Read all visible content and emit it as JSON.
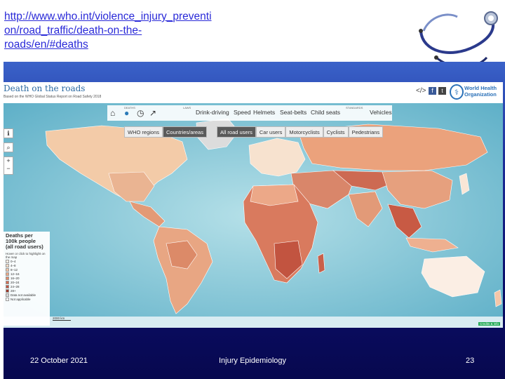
{
  "link": {
    "line1": "http://www.who.int/violence_injury_preventi",
    "line2": "on/road_traffic/death-on-the-",
    "line3": "roads/en/#deaths"
  },
  "screenshot": {
    "title": "Death on the roads",
    "subtitle": "Based on the WHO Global Status Report on Road Safety 2018",
    "who_name_line1": "World Health",
    "who_name_line2": "Organization",
    "toolbar": {
      "deaths_small": "DEATHS",
      "laws_small": "LAWS",
      "standards_small": "STANDARDS",
      "laws": [
        "Drink-driving",
        "Speed",
        "Helmets",
        "Seat-belts",
        "Child seats"
      ],
      "standards": [
        "Vehicles"
      ]
    },
    "region_tabs": [
      "WHO regions",
      "Countries/areas"
    ],
    "region_selected": "Countries/areas",
    "user_tabs": [
      "All road users",
      "Car users",
      "Motorcyclists",
      "Cyclists",
      "Pedestrians"
    ],
    "user_selected": "All road users",
    "legend": {
      "title_line1": "Deaths per",
      "title_line2": "100k people",
      "title_line3": "(all road users)",
      "hint": "Hover or click to highlight on the map",
      "items": [
        {
          "label": "0–4",
          "color": "#fbeee4"
        },
        {
          "label": "4–8",
          "color": "#f8dcc8"
        },
        {
          "label": "8–12",
          "color": "#f4c6a8"
        },
        {
          "label": "12–16",
          "color": "#eda886"
        },
        {
          "label": "16–20",
          "color": "#e48a68"
        },
        {
          "label": "20–24",
          "color": "#d56d52"
        },
        {
          "label": "24–28",
          "color": "#c2533f"
        },
        {
          "label": "28+",
          "color": "#9e3a2c"
        },
        {
          "label": "Data not available",
          "color": "#d8d8d8"
        },
        {
          "label": "Not applicable",
          "color": "#ffffff"
        }
      ]
    },
    "scale_label": "2000 km",
    "credit": "Credits & info"
  },
  "footer": {
    "date": "22 October 2021",
    "course": "Injury Epidemiology",
    "page": "23"
  },
  "colors": {
    "link": "#2a2ad8",
    "band_top": "#3a62c9",
    "band_bottom": "#07084e",
    "ocean": "#8ec9d8",
    "land_light": "#f6d9bf",
    "land_mid": "#eaa47e",
    "land_dark": "#c5573f"
  }
}
